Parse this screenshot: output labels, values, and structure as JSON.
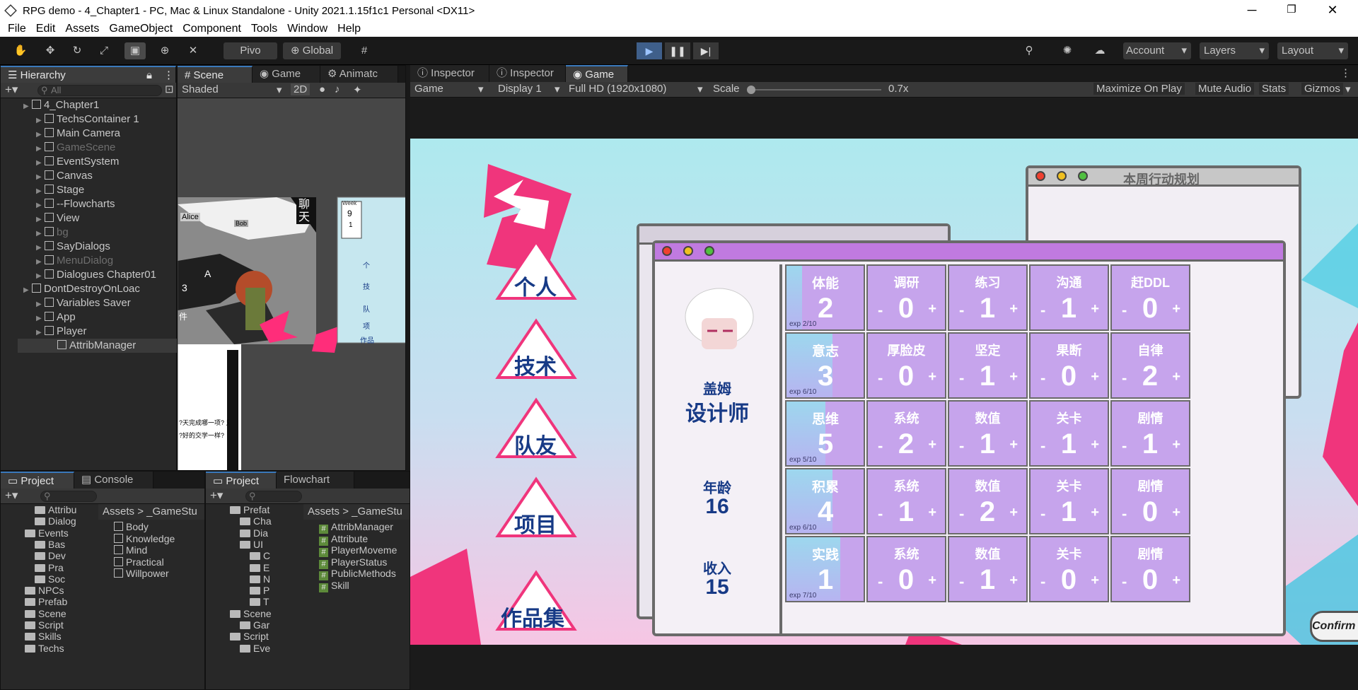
{
  "window": {
    "title": "RPG demo - 4_Chapter1 - PC, Mac & Linux Standalone - Unity 2021.1.15f1c1 Personal <DX11>",
    "minimize": "─",
    "restore": "❐",
    "close": "✕"
  },
  "menu": [
    "File",
    "Edit",
    "Assets",
    "GameObject",
    "Component",
    "Tools",
    "Window",
    "Help"
  ],
  "toolbar": {
    "pivot": "Pivo",
    "global": "Global",
    "account": "Account",
    "layers": "Layers",
    "layout": "Layout"
  },
  "hierarchy": {
    "tab": "Hierarchy",
    "search_placeholder": "All",
    "rows": [
      {
        "label": "4_Chapter1",
        "level": 0,
        "kind": "scene",
        "dim": false
      },
      {
        "label": "TechsContainer 1",
        "level": 1,
        "kind": "go",
        "dim": false
      },
      {
        "label": "Main Camera",
        "level": 1,
        "kind": "go",
        "dim": false
      },
      {
        "label": "GameScene",
        "level": 1,
        "kind": "go",
        "dim": true
      },
      {
        "label": "EventSystem",
        "level": 1,
        "kind": "go",
        "dim": false
      },
      {
        "label": "Canvas",
        "level": 1,
        "kind": "go",
        "dim": false
      },
      {
        "label": "Stage",
        "level": 1,
        "kind": "go",
        "dim": false
      },
      {
        "label": "--Flowcharts",
        "level": 1,
        "kind": "go",
        "dim": false
      },
      {
        "label": "View",
        "level": 1,
        "kind": "go",
        "dim": false
      },
      {
        "label": "bg",
        "level": 1,
        "kind": "go",
        "dim": true
      },
      {
        "label": "SayDialogs",
        "level": 1,
        "kind": "go",
        "dim": false
      },
      {
        "label": "MenuDialog",
        "level": 1,
        "kind": "go",
        "dim": true
      },
      {
        "label": "Dialogues Chapter01",
        "level": 1,
        "kind": "go",
        "dim": false
      },
      {
        "label": "DontDestroyOnLoac",
        "level": 0,
        "kind": "scene",
        "dim": false
      },
      {
        "label": "Variables Saver",
        "level": 1,
        "kind": "go",
        "dim": false
      },
      {
        "label": "App",
        "level": 1,
        "kind": "go",
        "dim": false
      },
      {
        "label": "Player",
        "level": 1,
        "kind": "go",
        "dim": false
      },
      {
        "label": "AttribManager",
        "level": 2,
        "kind": "go",
        "dim": false
      }
    ]
  },
  "scene_tabs": [
    "Scene",
    "Game",
    "Animatc"
  ],
  "scene_bar": {
    "shading": "Shaded",
    "mode": "2D"
  },
  "scene_preview": {
    "week": "Week",
    "week_num": "9",
    "sub": "1",
    "chat": "聊天",
    "names": [
      "Alice",
      "Bob"
    ],
    "labels": [
      "A",
      "3",
      "件"
    ],
    "text_lines": [
      "?天完成哪一项? 兄",
      "?好的交学一样?"
    ],
    "side_chars": [
      "个",
      "技",
      "队",
      "项",
      "作品"
    ]
  },
  "inspector_tabs": [
    "Inspector",
    "Inspector",
    "Game"
  ],
  "game_bar": {
    "view": "Game",
    "display": "Display 1",
    "resolution": "Full HD (1920x1080)",
    "scale_label": "Scale",
    "scale_value": "0.7x",
    "maximize": "Maximize On Play",
    "mute": "Mute Audio",
    "stats": "Stats",
    "gizmos": "Gizmos"
  },
  "project1": {
    "tabs": [
      "Project",
      "Console"
    ],
    "breadcrumb": [
      "Assets",
      ">",
      "_GameStu"
    ],
    "tree": [
      "Attribu",
      "Dialog",
      "Events",
      "Bas",
      "Dev",
      "Pra",
      "Soc",
      "NPCs",
      "Prefab",
      "Scene",
      "Script",
      "Skills",
      "Techs"
    ],
    "files": [
      "Body",
      "Knowledge",
      "Mind",
      "Practical",
      "Willpower"
    ]
  },
  "project2": {
    "tabs": [
      "Project",
      "Flowchart"
    ],
    "breadcrumb": [
      "Assets",
      ">",
      "_GameStu"
    ],
    "tree": [
      "Prefat",
      "Cha",
      "Dia",
      "UI",
      "C",
      "E",
      "N",
      "P",
      "T",
      "Scene",
      "Gar",
      "Script",
      "Eve"
    ],
    "files": [
      "AttribManager",
      "Attribute",
      "PlayerMoveme",
      "PlayerStatus",
      "PublicMethods",
      "Skill"
    ]
  },
  "game": {
    "menu_items": [
      "个人",
      "技术",
      "队友",
      "项目",
      "作品集"
    ],
    "plan_title": "本周行动规划",
    "profile": {
      "name": "盖姆",
      "role": "设计师",
      "age_label": "年龄",
      "age": "16",
      "income_label": "收入",
      "income": "15"
    },
    "attributes": [
      {
        "name": "体能",
        "value": "2",
        "exp": "exp 2/10",
        "fill": 0.2
      },
      {
        "name": "意志",
        "value": "3",
        "exp": "exp 6/10",
        "fill": 0.6
      },
      {
        "name": "思维",
        "value": "5",
        "exp": "exp 5/10",
        "fill": 0.5
      },
      {
        "name": "积累",
        "value": "4",
        "exp": "exp 6/10",
        "fill": 0.6
      },
      {
        "name": "实践",
        "value": "1",
        "exp": "exp 7/10",
        "fill": 0.7
      }
    ],
    "grid": [
      [
        {
          "l": "调研",
          "v": "0"
        },
        {
          "l": "练习",
          "v": "1"
        },
        {
          "l": "沟通",
          "v": "1"
        },
        {
          "l": "赶DDL",
          "v": "0"
        }
      ],
      [
        {
          "l": "厚脸皮",
          "v": "0"
        },
        {
          "l": "坚定",
          "v": "1"
        },
        {
          "l": "果断",
          "v": "0"
        },
        {
          "l": "自律",
          "v": "2"
        }
      ],
      [
        {
          "l": "系统",
          "v": "2"
        },
        {
          "l": "数值",
          "v": "1"
        },
        {
          "l": "关卡",
          "v": "1"
        },
        {
          "l": "剧情",
          "v": "1"
        }
      ],
      [
        {
          "l": "系统",
          "v": "1"
        },
        {
          "l": "数值",
          "v": "2"
        },
        {
          "l": "关卡",
          "v": "1"
        },
        {
          "l": "剧情",
          "v": "0"
        }
      ],
      [
        {
          "l": "系统",
          "v": "0"
        },
        {
          "l": "数值",
          "v": "1"
        },
        {
          "l": "关卡",
          "v": "0"
        },
        {
          "l": "剧情",
          "v": "0"
        }
      ]
    ],
    "minus": "-",
    "plus": "+",
    "confirm": "Confirm button"
  },
  "colors": {
    "accent": "#f0357c",
    "navy": "#173a86",
    "cell": "#c6a4ec",
    "window_bar": "#c07ae0",
    "play_blue": "#3a79bb"
  }
}
